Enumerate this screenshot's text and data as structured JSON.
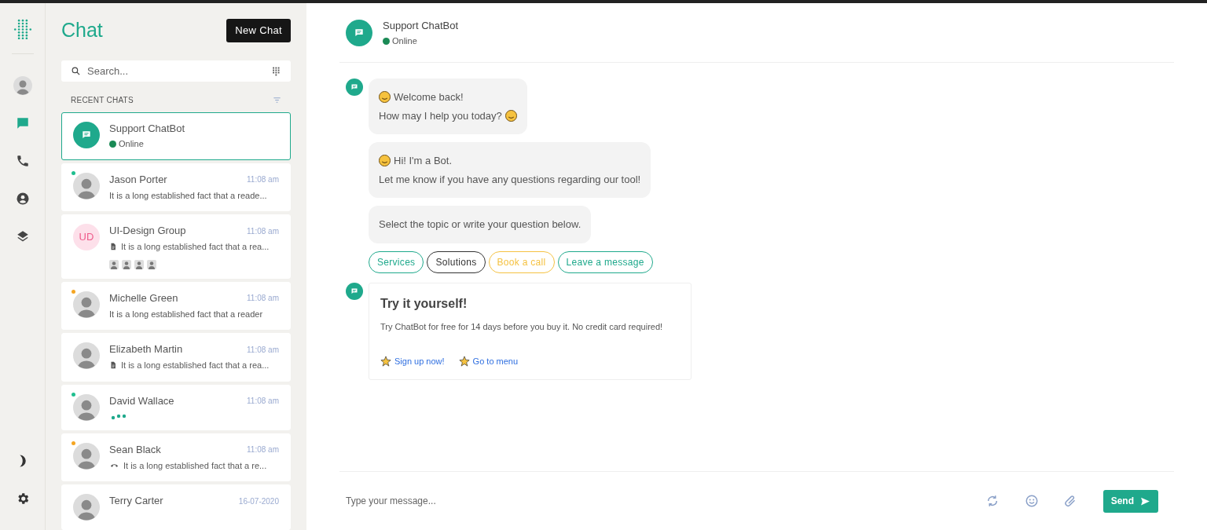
{
  "sidebar": {
    "profile": {
      "kind": "avatar"
    },
    "nav": [
      {
        "kind": "chat",
        "selected": true
      },
      {
        "kind": "phone",
        "selected": false
      },
      {
        "kind": "contact",
        "selected": false
      },
      {
        "kind": "layers",
        "selected": false
      }
    ],
    "bottom": [
      {
        "kind": "moon"
      },
      {
        "kind": "settings"
      }
    ]
  },
  "chat_list": {
    "title": "Chat",
    "new_button": "New Chat",
    "search": {
      "placeholder": "Search..."
    },
    "section_label": "RECENT CHATS",
    "chats": [
      {
        "kind": "bot",
        "name": "Support ChatBot",
        "status": "Online",
        "selected": true
      },
      {
        "kind": "person",
        "name": "Jason Porter",
        "time": "11:08 am",
        "preview": {
          "kind": "text",
          "text": "It is a long established fact that a reade..."
        },
        "color": "#1fbf8f",
        "selected": false
      },
      {
        "kind": "group",
        "name": "UI-Design Group",
        "initials": "UD",
        "time": "11:08 am",
        "preview": {
          "kind": "file",
          "text": "It is a long established fact that a rea..."
        },
        "selected": false
      },
      {
        "kind": "person",
        "name": "Michelle Green",
        "time": "11:08 am",
        "preview": {
          "kind": "text",
          "text": "It is a long established fact that a reader"
        },
        "color": "#f5a623",
        "selected": false
      },
      {
        "kind": "person",
        "name": "Elizabeth Martin",
        "time": "11:08 am",
        "preview": {
          "kind": "file",
          "text": "It is a long established fact that a rea..."
        },
        "selected": false
      },
      {
        "kind": "person",
        "name": "David Wallace",
        "time": "11:08 am",
        "preview": {
          "kind": "typing"
        },
        "color": "#1fbf8f",
        "selected": false
      },
      {
        "kind": "person",
        "name": "Sean Black",
        "time": "11:08 am",
        "preview": {
          "kind": "call",
          "text": "It is a long established fact that a re..."
        },
        "color": "#f5a623",
        "selected": false
      },
      {
        "kind": "person",
        "name": "Terry Carter",
        "time": "16-07-2020",
        "selected": false
      }
    ]
  },
  "conversation": {
    "header": {
      "name": "Support ChatBot",
      "status": "Online"
    },
    "messages": [
      {
        "kind": "bubbles",
        "avatar": true,
        "bubbles": [
          {
            "lines": [
              {
                "text": "Welcome back!",
                "lead_emoji": true
              },
              {
                "text": "How may I help you today?",
                "trail_emoji": true
              }
            ]
          }
        ]
      },
      {
        "kind": "bubbles",
        "avatar": false,
        "bubbles": [
          {
            "lines": [
              {
                "text": "Hi! I'm a Bot.",
                "lead_emoji": true
              },
              {
                "text": "Let me know if you have any questions regarding our tool!"
              }
            ]
          },
          {
            "lines": [
              {
                "text": "Select the topic or write your question below."
              }
            ]
          }
        ]
      },
      {
        "kind": "options",
        "options": [
          {
            "label": "Services",
            "color": "#1fa98c"
          },
          {
            "label": "Solutions",
            "color": "#333333"
          },
          {
            "label": "Book a call",
            "color": "#f5c242"
          },
          {
            "label": "Leave a message",
            "color": "#1fa98c"
          }
        ]
      },
      {
        "kind": "card",
        "avatar": true,
        "title": "Try it yourself!",
        "text": "Try ChatBot for free for 14 days before you buy it. No credit card required!",
        "links": [
          {
            "label": "Sign up now!"
          },
          {
            "label": "Go to menu"
          }
        ]
      }
    ],
    "composer": {
      "placeholder": "Type your message...",
      "send": "Send"
    }
  }
}
